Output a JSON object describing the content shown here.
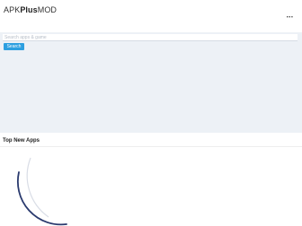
{
  "header": {
    "logo_prefix": "APK",
    "logo_bold": "Plus",
    "logo_suffix": "MOD",
    "menu_icon": "menu-icon"
  },
  "search": {
    "placeholder": "Search apps & game",
    "button_label": "Search"
  },
  "section": {
    "title": "Top New Apps"
  },
  "loader": {
    "icon": "loading-spinner-icon"
  },
  "colors": {
    "accent": "#2d9fe0",
    "search_band": "#edf1f6",
    "spinner": "#2a3a6e"
  }
}
